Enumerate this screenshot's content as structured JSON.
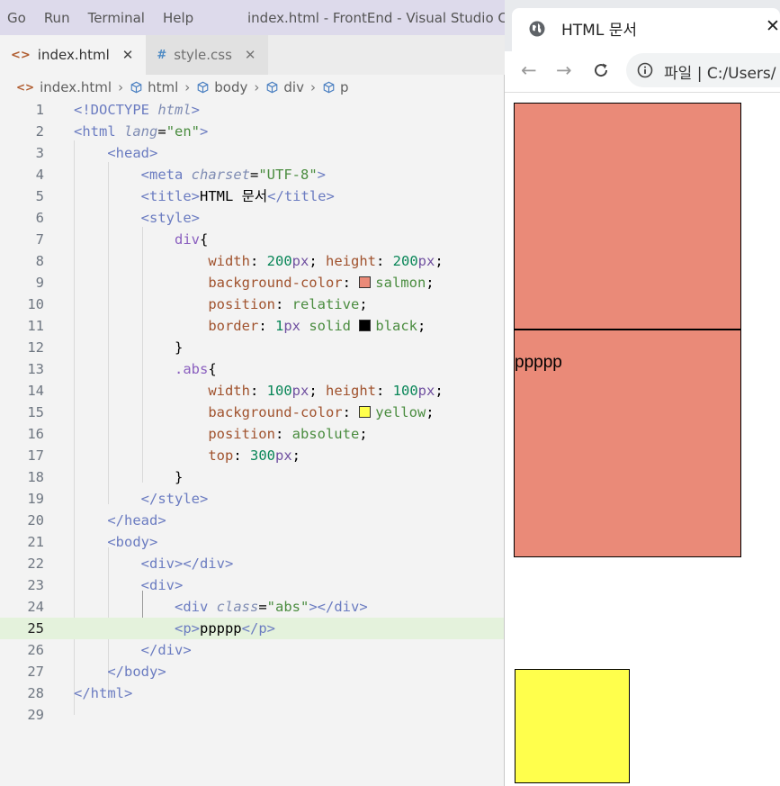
{
  "vscode": {
    "menu": [
      "Go",
      "Run",
      "Terminal",
      "Help"
    ],
    "window_title": "index.html - FrontEnd - Visual Studio Code",
    "tabs": [
      {
        "icon": "<>",
        "label": "index.html",
        "close": "✕"
      },
      {
        "icon": "#",
        "label": "style.css",
        "close": "✕"
      }
    ],
    "breadcrumb": [
      "index.html",
      "html",
      "body",
      "div",
      "p"
    ],
    "highlighted_line": 25,
    "colors": {
      "salmon": "#ea8a78",
      "yellow": "#ffff4c",
      "black": "#000000"
    }
  },
  "browser": {
    "tab_title": "HTML 문서",
    "tab_close": "✕",
    "address_label": "파일",
    "address_sep": "|",
    "address_text": "C:/Users/",
    "page_text": "ppppp"
  }
}
